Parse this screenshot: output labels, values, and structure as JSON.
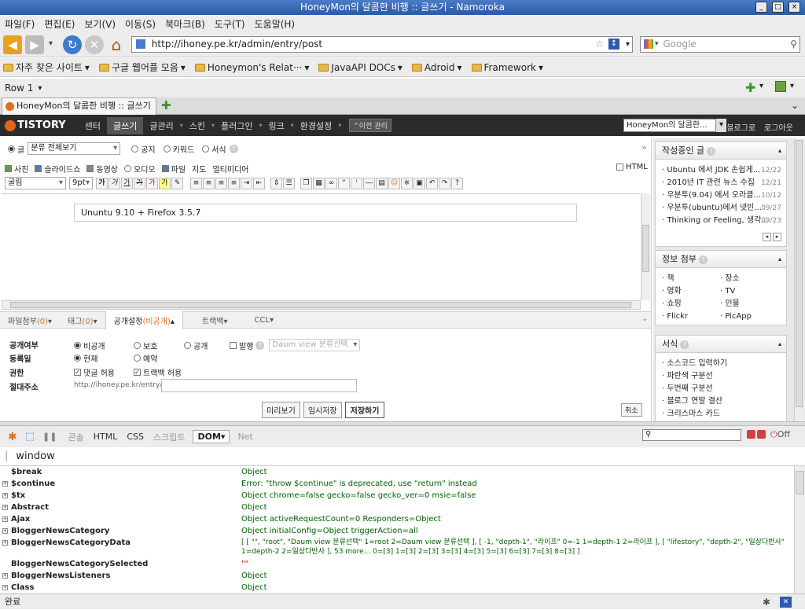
{
  "window": {
    "title": "HoneyMon의 달콤한 비행 :: 글쓰기 - Namoroka"
  },
  "menu": [
    "파일(F)",
    "편집(E)",
    "보기(V)",
    "이동(S)",
    "북마크(B)",
    "도구(T)",
    "도움말(H)"
  ],
  "nav": {
    "url": "http://ihoney.pe.kr/admin/entry/post",
    "search_placeholder": "Google"
  },
  "bookmarks": [
    "자주 찾은 사이트",
    "구글 웹어플 모음",
    "Honeymon's Relat···",
    "JavaAPI DOCs",
    "Adroid",
    "Framework"
  ],
  "rowbar": {
    "label": "Row 1"
  },
  "tabs": [
    {
      "label": "HoneyMon의 달콤한 비행 :: 글쓰기"
    }
  ],
  "tistory": {
    "logo": "TISTORY",
    "menu": [
      "센터",
      "글쓰기",
      "글관리",
      "스킨",
      "플러그인",
      "링크",
      "환경설정"
    ],
    "prev_admin": "이전 관리",
    "blog_select": "HoneyMon의 달콤한...",
    "blog_home": "블로그로",
    "logout": "로그아웃"
  },
  "editor": {
    "type_options": {
      "post": "글",
      "notice": "공지",
      "keyword": "키워드",
      "form": "서식"
    },
    "category": "분류 전체보기",
    "media": [
      "사진",
      "슬라이드쇼",
      "동영상",
      "오디오",
      "파일",
      "지도",
      "멀티미디어"
    ],
    "html_label": "HTML",
    "font": "굴림",
    "size": "9pt",
    "title_value": "Ununtu 9.10 + Firefox 3.5.7",
    "bottom_tabs": [
      "파일첨부",
      "(0)",
      "태그",
      "(0)",
      "공개설정",
      "(비공개)",
      "트랙백",
      "CCL"
    ],
    "settings": {
      "visibility_label": "공개여부",
      "visibility": [
        "비공개",
        "보호",
        "공개"
      ],
      "publish": "발행",
      "daum_select": "Daum view 분류선택",
      "date_label": "등록일",
      "date": [
        "현재",
        "예약"
      ],
      "perm_label": "권한",
      "perm": [
        "댓글 허용",
        "트랙백 허용"
      ],
      "abs_label": "절대주소",
      "abs_prefix": "http://ihoney.pe.kr/entry/"
    },
    "buttons": {
      "preview": "미리보기",
      "temp": "임시저장",
      "save": "저장하기",
      "cancel": "취소"
    }
  },
  "sidebar": {
    "writing": {
      "title": "작성중인 글",
      "items": [
        {
          "t": "Ubuntu 에서 JDK 손쉽게...",
          "d": "12/22"
        },
        {
          "t": "2010년 IT 관련 뉴스 수집",
          "d": "12/21"
        },
        {
          "t": "우분투(9.04) 에서 오라클...",
          "d": "10/12"
        },
        {
          "t": "우분투(ubuntu)에서 넷빈...",
          "d": "09/27"
        },
        {
          "t": "Thinking or Feeling, 생각...",
          "d": "09/23"
        }
      ]
    },
    "info": {
      "title": "정보 첨부",
      "col1": [
        "책",
        "영화",
        "쇼핑",
        "Flickr"
      ],
      "col2": [
        "장소",
        "TV",
        "인물",
        "PicApp"
      ]
    },
    "forms": {
      "title": "서식",
      "items": [
        "소스코드 입력하기",
        "파란색 구분선",
        "두번째 구분선",
        "블로그 연말 결산",
        "크리스마스 카드"
      ]
    }
  },
  "firebug": {
    "tabs": [
      "콘솔",
      "HTML",
      "CSS",
      "스크립트",
      "DOM",
      "Net"
    ],
    "off": "Off",
    "window_label": "window",
    "rows": [
      {
        "k": "$break",
        "v": "Object",
        "exp": false
      },
      {
        "k": "$continue",
        "v": "Error: \"throw $continue\" is deprecated, use \"return\" instead",
        "exp": true
      },
      {
        "k": "$tx",
        "v": "Object chrome=false gecko=false gecko_ver=0 msie=false",
        "exp": true
      },
      {
        "k": "Abstract",
        "v": "Object",
        "exp": true
      },
      {
        "k": "Ajax",
        "v": "Object activeRequestCount=0 Responders=Object",
        "exp": true
      },
      {
        "k": "BloggerNewsCategory",
        "v": "Object initialConfig=Object triggerAction=all",
        "exp": true
      },
      {
        "k": "BloggerNewsCategoryData",
        "v": "[ [ \"\", \"root\", \"Daum view 분류선택\" 1=root 2=Daum view 분류선택 ], [ -1, \"depth-1\", \"라이프\" 0=-1 1=depth-1 2=라이프 ], [ \"lifestory\", \"depth-2\", \"일상다반사\" 0=lifestory",
        "v2": "1=depth-2 2=일상다반사 ], 53 more... 0=[3] 1=[3] 2=[3] 3=[3] 4=[3] 5=[3] 6=[3] 7=[3] 8=[3] ]",
        "exp": true
      },
      {
        "k": "BloggerNewsCategorySelected",
        "v": "\"\"",
        "exp": false
      },
      {
        "k": "BloggerNewsListeners",
        "v": "Object",
        "exp": true
      },
      {
        "k": "Class",
        "v": "Object",
        "exp": true
      }
    ]
  },
  "status": {
    "text": "완료"
  }
}
